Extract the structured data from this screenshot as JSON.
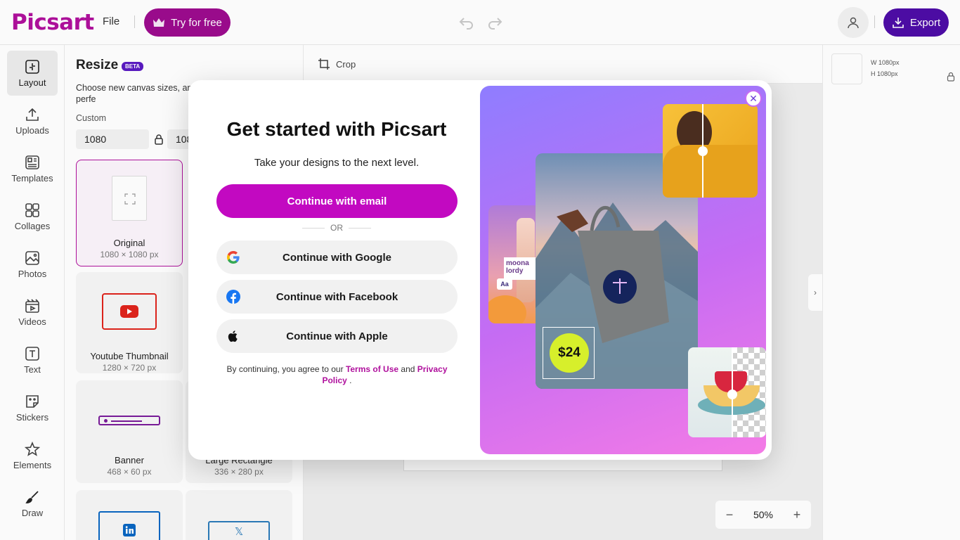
{
  "app": {
    "logo": "Picsart"
  },
  "topbar": {
    "file_label": "File",
    "try_label": "Try for free",
    "export_label": "Export"
  },
  "leftnav": {
    "items": [
      {
        "label": "Layout",
        "icon": "layout-icon"
      },
      {
        "label": "Uploads",
        "icon": "upload-icon"
      },
      {
        "label": "Templates",
        "icon": "templates-icon"
      },
      {
        "label": "Collages",
        "icon": "collages-icon"
      },
      {
        "label": "Photos",
        "icon": "photos-icon"
      },
      {
        "label": "Videos",
        "icon": "videos-icon"
      },
      {
        "label": "Text",
        "icon": "text-icon"
      },
      {
        "label": "Stickers",
        "icon": "stickers-icon"
      },
      {
        "label": "Elements",
        "icon": "elements-icon"
      },
      {
        "label": "Draw",
        "icon": "draw-icon"
      }
    ]
  },
  "resize": {
    "title": "Resize",
    "badge": "BETA",
    "description": "Choose new canvas sizes, and to a ready-to-publish perfe",
    "custom_label": "Custom",
    "width_value": "1080",
    "height_value": "108",
    "cards": [
      {
        "name": "Original",
        "dims": "1080 × 1080 px"
      },
      {
        "name": "Youtube Thumbnail",
        "dims": "1280 × 720 px"
      },
      {
        "name": "Banner",
        "dims": "468 × 60 px"
      },
      {
        "name": "Large Rectangle",
        "dims": "336 × 280 px"
      }
    ]
  },
  "canvas": {
    "crop_label": "Crop",
    "zoom": "50%"
  },
  "rightpanel": {
    "width_label": "W 1080px",
    "height_label": "H 1080px"
  },
  "modal": {
    "title": "Get started with Picsart",
    "subtitle": "Take your designs to the next level.",
    "email_button": "Continue with email",
    "or_label": "OR",
    "google_button": "Continue with Google",
    "facebook_button": "Continue with Facebook",
    "apple_button": "Continue with Apple",
    "terms_prefix": "By continuing, you agree to our",
    "terms_link": "Terms of Use",
    "terms_and": "and",
    "privacy_link": "Privacy Policy",
    "terms_suffix": ".",
    "promo": {
      "price_tag": "$24",
      "text_card": "moona lordy",
      "text_badge": "Aa"
    }
  },
  "colors": {
    "brand": "#b0119d",
    "email_button": "#c209c1",
    "export_button": "#4e0da7",
    "try_button": "#9d0c8e"
  }
}
